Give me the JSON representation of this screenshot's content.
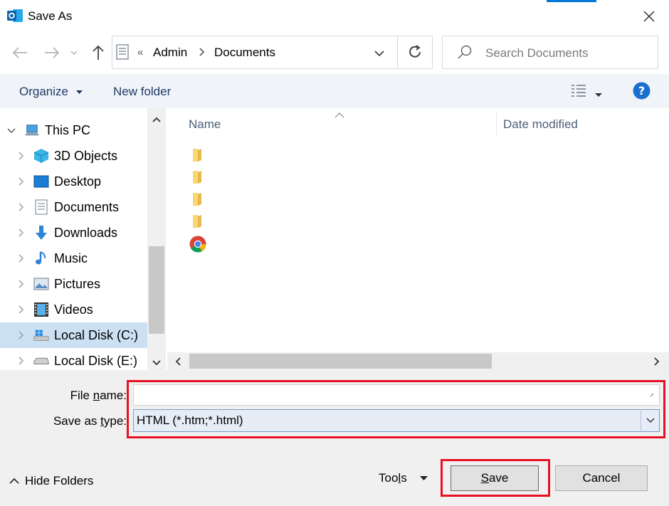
{
  "window": {
    "title": "Save As"
  },
  "address": {
    "overflow": "«",
    "crumbs": [
      "Admin",
      "Documents"
    ]
  },
  "search": {
    "placeholder": "Search Documents"
  },
  "toolbar": {
    "organize": "Organize",
    "new_folder": "New folder"
  },
  "tree": [
    {
      "label": "This PC",
      "icon": "computer-icon"
    },
    {
      "label": "3D Objects",
      "icon": "cube-icon"
    },
    {
      "label": "Desktop",
      "icon": "desktop-icon"
    },
    {
      "label": "Documents",
      "icon": "document-icon"
    },
    {
      "label": "Downloads",
      "icon": "download-arrow-icon"
    },
    {
      "label": "Music",
      "icon": "music-note-icon"
    },
    {
      "label": "Pictures",
      "icon": "picture-icon"
    },
    {
      "label": "Videos",
      "icon": "film-icon"
    },
    {
      "label": "Local Disk (C:)",
      "icon": "drive-windows-icon",
      "selected": true
    },
    {
      "label": "Local Disk (E:)",
      "icon": "drive-icon"
    }
  ],
  "columns": {
    "name": "Name",
    "date": "Date modified"
  },
  "files": [
    {
      "icon": "folder-icon"
    },
    {
      "icon": "folder-icon"
    },
    {
      "icon": "folder-icon"
    },
    {
      "icon": "folder-icon"
    },
    {
      "icon": "chrome-icon"
    }
  ],
  "form": {
    "file_name_label_pre": "File ",
    "file_name_label_ul": "n",
    "file_name_label_post": "ame:",
    "file_name_value": "",
    "save_type_label_pre": "Save as ",
    "save_type_label_ul": "t",
    "save_type_label_post": "ype:",
    "save_type_value": "HTML (*.htm;*.html)"
  },
  "footer": {
    "hide_folders": "Hide Folders",
    "tools_pre": "Too",
    "tools_ul": "l",
    "tools_post": "s",
    "save_ul": "S",
    "save_post": "ave",
    "cancel": "Cancel"
  },
  "colors": {
    "accent": "#0078d7",
    "highlight": "#e81123",
    "selected": "#cce0f4",
    "folder": "#f8d775"
  }
}
